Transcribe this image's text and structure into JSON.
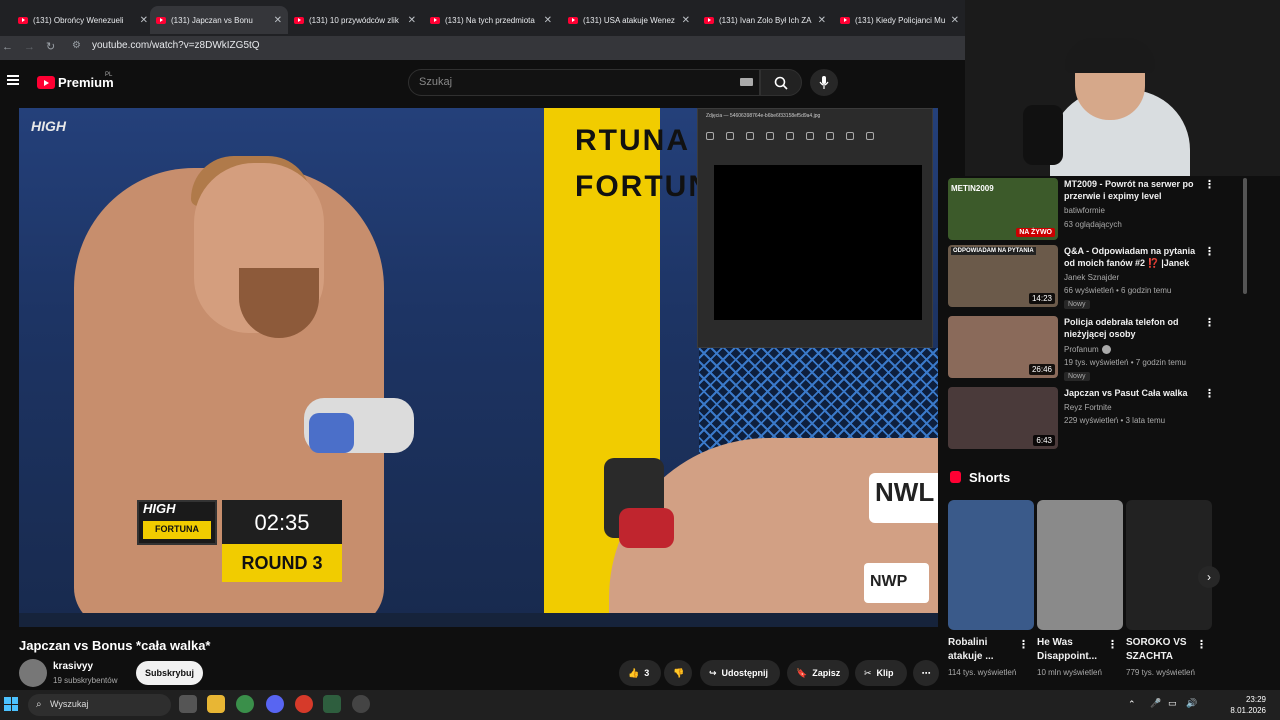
{
  "browser": {
    "tabs": [
      {
        "title": "(131) Obrońcy Wenezueli"
      },
      {
        "title": "(131) Japczan vs Bonu"
      },
      {
        "title": "(131) 10 przywódców zlik"
      },
      {
        "title": "(131) Na tych przedmiota"
      },
      {
        "title": "(131) USA atakuje Wenez"
      },
      {
        "title": "(131) Ivan Zolo Był Ich ZA"
      },
      {
        "title": "(131) Kiedy Policjanci Mu"
      }
    ],
    "url": "youtube.com/watch?v=z8DWkIZG5tQ"
  },
  "youtube": {
    "logo": "Premium",
    "region": "PL",
    "search_placeholder": "Szukaj"
  },
  "video": {
    "watermark": "HIGH",
    "pillar_text": "RTUNA FORTUNA",
    "score_logo": "HIGH",
    "score_brand": "FORTUNA",
    "time": "02:35",
    "round": "ROUND 3",
    "back_logo": "NWL",
    "back_logo2": "NWP",
    "viewer_title": "Zdjęcia — 54606398764e-b6be6f33158ef5d9a4.jpg"
  },
  "watch": {
    "title": "Japczan vs Bonus *cała walka*",
    "channel": "krasivyy",
    "subscribers": "19 subskrybentów",
    "subscribe_label": "Subskrybuj",
    "likes": "3",
    "share_label": "Udostępnij",
    "save_label": "Zapisz",
    "clip_label": "Klip"
  },
  "sidebar": {
    "videos": [
      {
        "title": "MT2009 - Powrót na serwer po przerwie i expimy level",
        "channel": "batiwformie",
        "meta": "63 oglądających",
        "badge": "NA ŻYWO",
        "thumb_text": "METIN2009",
        "color": "#3c5a2a"
      },
      {
        "title": "Q&A - Odpowiadam na pytania od moich fanów #2 ⁉️ |Janek",
        "channel": "Janek Sznajder",
        "meta": "66 wyświetleń • 6 godzin temu",
        "duration": "14:23",
        "new": "Nowy",
        "thumb_text": "ODPOWIADAM NA PYTANIA",
        "color": "#6b5a4a"
      },
      {
        "title": "Policja odebrała telefon od nieżyjącej osoby",
        "channel": "Profanum",
        "meta": "19 tys. wyświetleń • 7 godzin temu",
        "duration": "26:46",
        "new": "Nowy",
        "color": "#8a6a5a"
      },
      {
        "title": "Japczan vs Pasut Cała walka",
        "channel": "Reyz Fortnite",
        "meta": "229 wyświetleń • 3 lata temu",
        "duration": "6:43",
        "color": "#4a3a3a"
      }
    ],
    "shorts_label": "Shorts",
    "shorts": [
      {
        "title": "Robalini atakuje ...",
        "meta": "114 tys. wyświetleń",
        "color": "#3a5a8a"
      },
      {
        "title": "He Was Disappoint...",
        "meta": "10 mln wyświetleń",
        "color": "#8a8a8a"
      },
      {
        "title": "SOROKO VS SZACHTA",
        "meta": "779 tys. wyświetleń",
        "color": "#222"
      }
    ]
  },
  "taskbar": {
    "search_label": "Wyszukaj",
    "time": "23:29",
    "date": "8.01.2026"
  }
}
